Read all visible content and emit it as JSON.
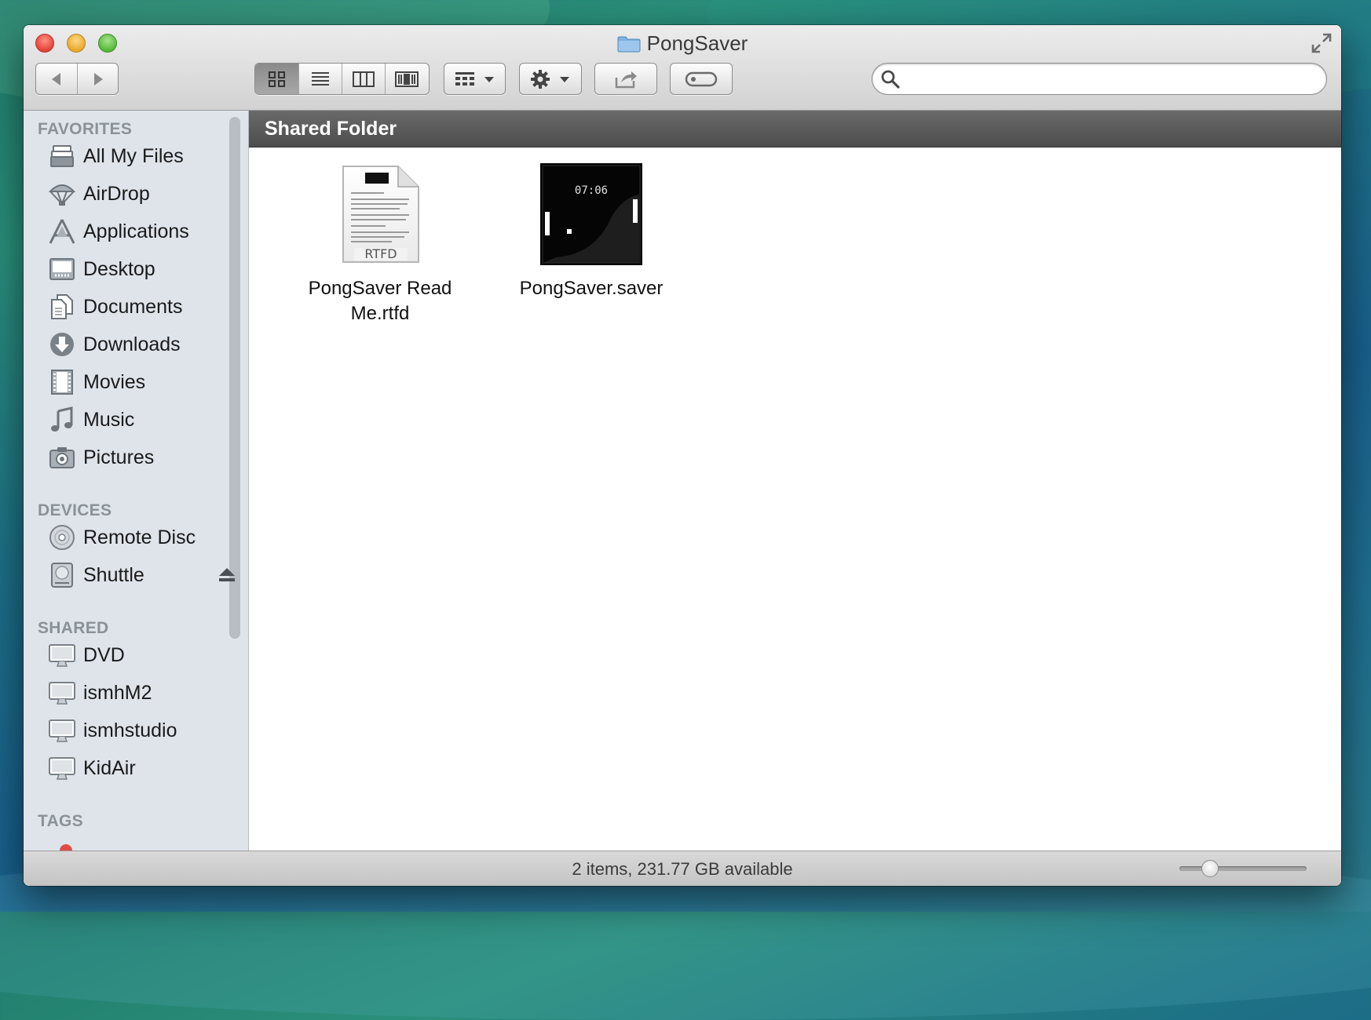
{
  "window": {
    "title": "PongSaver"
  },
  "toolbar": {
    "search_placeholder": ""
  },
  "sidebar": {
    "favorites_title": "FAVORITES",
    "favorites": [
      {
        "label": "All My Files",
        "icon": "all-files-icon"
      },
      {
        "label": "AirDrop",
        "icon": "airdrop-icon"
      },
      {
        "label": "Applications",
        "icon": "applications-icon"
      },
      {
        "label": "Desktop",
        "icon": "desktop-icon"
      },
      {
        "label": "Documents",
        "icon": "documents-icon"
      },
      {
        "label": "Downloads",
        "icon": "downloads-icon"
      },
      {
        "label": "Movies",
        "icon": "movies-icon"
      },
      {
        "label": "Music",
        "icon": "music-icon"
      },
      {
        "label": "Pictures",
        "icon": "pictures-icon"
      }
    ],
    "devices_title": "DEVICES",
    "devices": [
      {
        "label": "Remote Disc",
        "icon": "disc-icon"
      },
      {
        "label": "Shuttle",
        "icon": "drive-icon"
      }
    ],
    "shared_title": "SHARED",
    "shared": [
      {
        "label": "DVD",
        "icon": "computer-icon"
      },
      {
        "label": "ismhM2",
        "icon": "computer-icon"
      },
      {
        "label": "ismhstudio",
        "icon": "computer-icon"
      },
      {
        "label": "KidAir",
        "icon": "computer-icon"
      }
    ],
    "tags_title": "TAGS"
  },
  "content": {
    "header": "Shared Folder",
    "files": [
      {
        "name_line1": "PongSaver Read",
        "name_line2": "Me.rtfd",
        "badge": "RTFD",
        "icon": "rtfd-document-icon"
      },
      {
        "name_line1": "PongSaver.saver",
        "name_line2": "",
        "clock": "07:06",
        "icon": "screensaver-icon"
      }
    ]
  },
  "statusbar": {
    "text": "2 items, 231.77 GB available",
    "icon_size_fraction": 0.2
  },
  "colors": {
    "accent_header": "#4d4d4d",
    "sidebar_bg": "#dfe4ea",
    "folder_blue": "#7fb2e0"
  }
}
